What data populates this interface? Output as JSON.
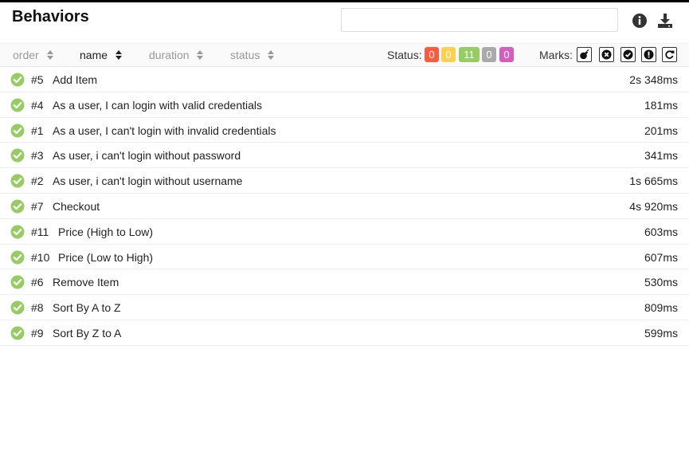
{
  "header": {
    "title": "Behaviors",
    "search_value": ""
  },
  "sorters": [
    {
      "label": "order",
      "active": false
    },
    {
      "label": "name",
      "active": true
    },
    {
      "label": "duration",
      "active": false
    },
    {
      "label": "status",
      "active": false
    }
  ],
  "status_filter": {
    "label": "Status:",
    "counts": {
      "failed": "0",
      "broken": "0",
      "passed": "11",
      "skipped": "0",
      "unknown": "0"
    },
    "colors": {
      "failed": "#fd5a3e",
      "broken": "#ffd050",
      "passed": "#97cc64",
      "skipped": "#aaaaaa",
      "unknown": "#d35ebe"
    }
  },
  "marks": {
    "label": "Marks:",
    "icons": [
      "bomb-icon",
      "times-circle-icon",
      "check-circle-icon",
      "exclamation-circle-icon",
      "refresh-icon"
    ]
  },
  "tests": [
    {
      "order": "#5",
      "name": "Add Item",
      "duration": "2s 348ms",
      "status": "passed"
    },
    {
      "order": "#4",
      "name": "As a user, I can login with valid credentials",
      "duration": "181ms",
      "status": "passed"
    },
    {
      "order": "#1",
      "name": "As a user, I can't login with invalid credentials",
      "duration": "201ms",
      "status": "passed"
    },
    {
      "order": "#3",
      "name": "As user, i can't login without password",
      "duration": "341ms",
      "status": "passed"
    },
    {
      "order": "#2",
      "name": "As user, i can't login without username",
      "duration": "1s 665ms",
      "status": "passed"
    },
    {
      "order": "#7",
      "name": "Checkout",
      "duration": "4s 920ms",
      "status": "passed"
    },
    {
      "order": "#11",
      "name": "Price (High to Low)",
      "duration": "603ms",
      "status": "passed"
    },
    {
      "order": "#10",
      "name": "Price (Low to High)",
      "duration": "607ms",
      "status": "passed"
    },
    {
      "order": "#6",
      "name": "Remove Item",
      "duration": "530ms",
      "status": "passed"
    },
    {
      "order": "#8",
      "name": "Sort By A to Z",
      "duration": "809ms",
      "status": "passed"
    },
    {
      "order": "#9",
      "name": "Sort By Z to A",
      "duration": "599ms",
      "status": "passed"
    }
  ]
}
